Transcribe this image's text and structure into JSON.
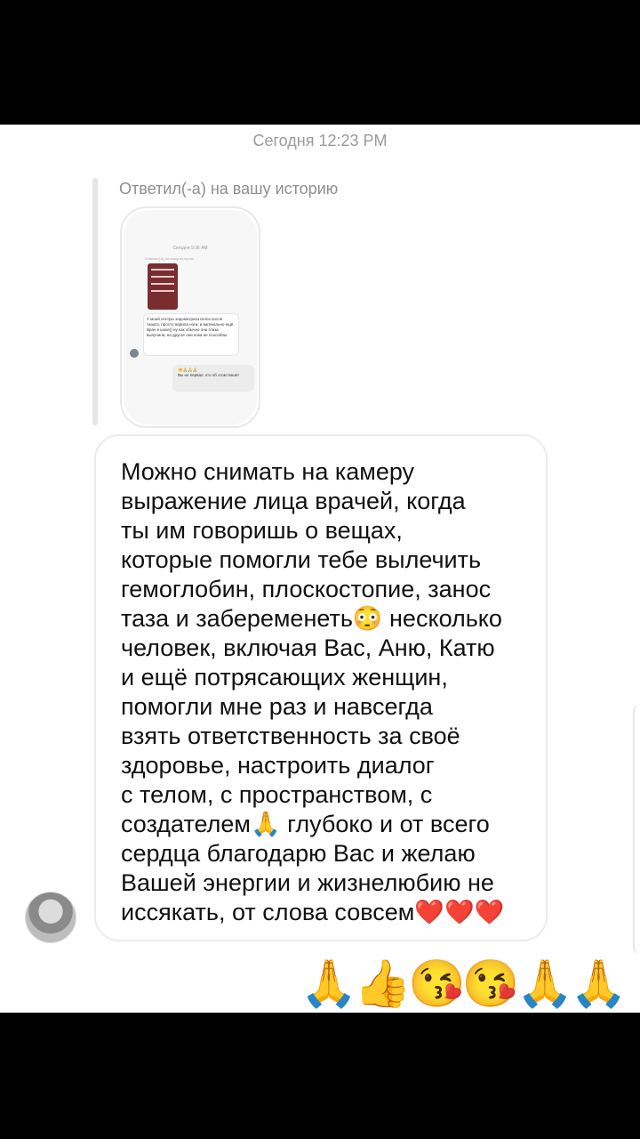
{
  "chat": {
    "timestamp": "Сегодня 12:23 PM",
    "reply_label": "Ответил(-а) на вашу историю",
    "story_preview": {
      "timestamp": "Сегодня 9:36 AM",
      "reply_label": "Ответил(-а) на вашу историю",
      "message": "У моей сестры эндометриоз исчез после тазиса, просто парила ноги, и вагинально ещё. Врач в шоке)) ну как обычно они глаза выпучили, на другое они пока не способны",
      "reply": "Вы не первая, кто об этом пишет",
      "reply_emoji": "👏🙏🙏🙏"
    },
    "message_text": "Можно снимать на камеру\nвыражение лица врачей, когда\nты им говоришь о вещах,\nкоторые помогли тебе вылечить\nгемоглобин, плоскостопие, занос\nтаза и забеременеть😳 несколько\nчеловек, включая Вас, Аню, Катю\nи ещё потрясающих женщин,\nпомогли мне раз и навсегда\nвзять ответственность за своё\nздоровье, настроить диалог\nс телом, с пространством, с\nсоздателем🙏 глубоко и от всего\nсердца благодарю Вас и желаю\nВашей энергии и жизнелюбию не\nиссякать, от слова совсем❤️❤️❤️",
    "reaction_emojis": "🙏👍😘😘🙏🙏",
    "avatar_icon": "user-avatar"
  }
}
